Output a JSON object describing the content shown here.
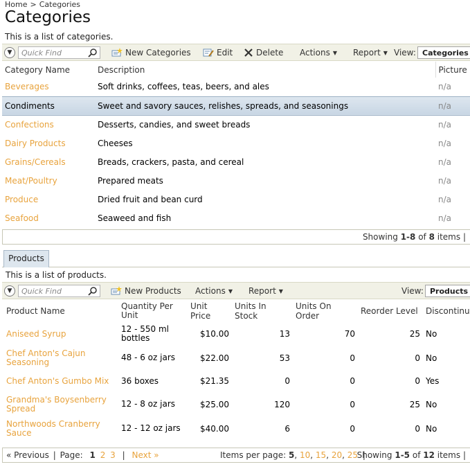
{
  "breadcrumb": {
    "home": "Home",
    "separator": ">",
    "current": "Categories"
  },
  "page": {
    "title": "Categories",
    "description": "This is a list of categories."
  },
  "categories_toolbar": {
    "quick_find_placeholder": "Quick Find",
    "new_label": "New Categories",
    "edit_label": "Edit",
    "delete_label": "Delete",
    "actions_label": "Actions",
    "report_label": "Report",
    "view_label": "View:",
    "view_value": "Categories"
  },
  "categories_grid": {
    "columns": [
      "Category Name",
      "Description",
      "Picture"
    ],
    "rows": [
      {
        "name": "Beverages",
        "description": "Soft drinks, coffees, teas, beers, and ales",
        "picture": "n/a"
      },
      {
        "name": "Condiments",
        "description": "Sweet and savory sauces, relishes, spreads, and seasonings",
        "picture": "n/a",
        "selected": true
      },
      {
        "name": "Confections",
        "description": "Desserts, candies, and sweet breads",
        "picture": "n/a"
      },
      {
        "name": "Dairy Products",
        "description": "Cheeses",
        "picture": "n/a"
      },
      {
        "name": "Grains/Cereals",
        "description": "Breads, crackers, pasta, and cereal",
        "picture": "n/a"
      },
      {
        "name": "Meat/Poultry",
        "description": "Prepared meats",
        "picture": "n/a"
      },
      {
        "name": "Produce",
        "description": "Dried fruit and bean curd",
        "picture": "n/a"
      },
      {
        "name": "Seafood",
        "description": "Seaweed and fish",
        "picture": "n/a"
      }
    ],
    "status": {
      "prefix": "Showing ",
      "range": "1-8",
      "of": " of ",
      "total": "8",
      "suffix": " items",
      "bar": "|"
    }
  },
  "products_tab": {
    "label": "Products"
  },
  "products": {
    "description": "This is a list of products.",
    "toolbar": {
      "quick_find_placeholder": "Quick Find",
      "new_label": "New Products",
      "actions_label": "Actions",
      "report_label": "Report",
      "view_label": "View:",
      "view_value": "Products"
    },
    "columns": [
      "Product Name",
      "Quantity Per Unit",
      "Unit Price",
      "Units In Stock",
      "Units On Order",
      "Reorder Level",
      "Discontinued"
    ],
    "rows": [
      {
        "name": "Aniseed Syrup",
        "qty": "12 - 550 ml bottles",
        "price": "$10.00",
        "stock": "13",
        "order": "70",
        "reorder": "25",
        "disc": "No"
      },
      {
        "name": "Chef Anton's Cajun Seasoning",
        "qty": "48 - 6 oz jars",
        "price": "$22.00",
        "stock": "53",
        "order": "0",
        "reorder": "0",
        "disc": "No"
      },
      {
        "name": "Chef Anton's Gumbo Mix",
        "qty": "36 boxes",
        "price": "$21.35",
        "stock": "0",
        "order": "0",
        "reorder": "0",
        "disc": "Yes"
      },
      {
        "name": "Grandma's Boysenberry Spread",
        "qty": "12 - 8 oz jars",
        "price": "$25.00",
        "stock": "120",
        "order": "0",
        "reorder": "25",
        "disc": "No"
      },
      {
        "name": "Northwoods Cranberry Sauce",
        "qty": "12 - 12 oz jars",
        "price": "$40.00",
        "stock": "6",
        "order": "0",
        "reorder": "0",
        "disc": "No"
      }
    ],
    "pager": {
      "previous": "« Previous",
      "page_label": "Page:",
      "pages": [
        "1",
        "2",
        "3"
      ],
      "next": "Next »",
      "items_per_page_label": "Items per page:",
      "page_sizes": [
        "5",
        "10",
        "15",
        "20",
        "25"
      ],
      "status": {
        "prefix": "Showing ",
        "range": "1-5",
        "of": " of ",
        "total": "12",
        "suffix": " items",
        "bar": "|"
      }
    }
  },
  "colors": {
    "link": "#e8a33d",
    "toolbar_bg": "#f1f1e6",
    "selected_row": "#c8d6e4",
    "tab_bg": "#dde6ee"
  }
}
